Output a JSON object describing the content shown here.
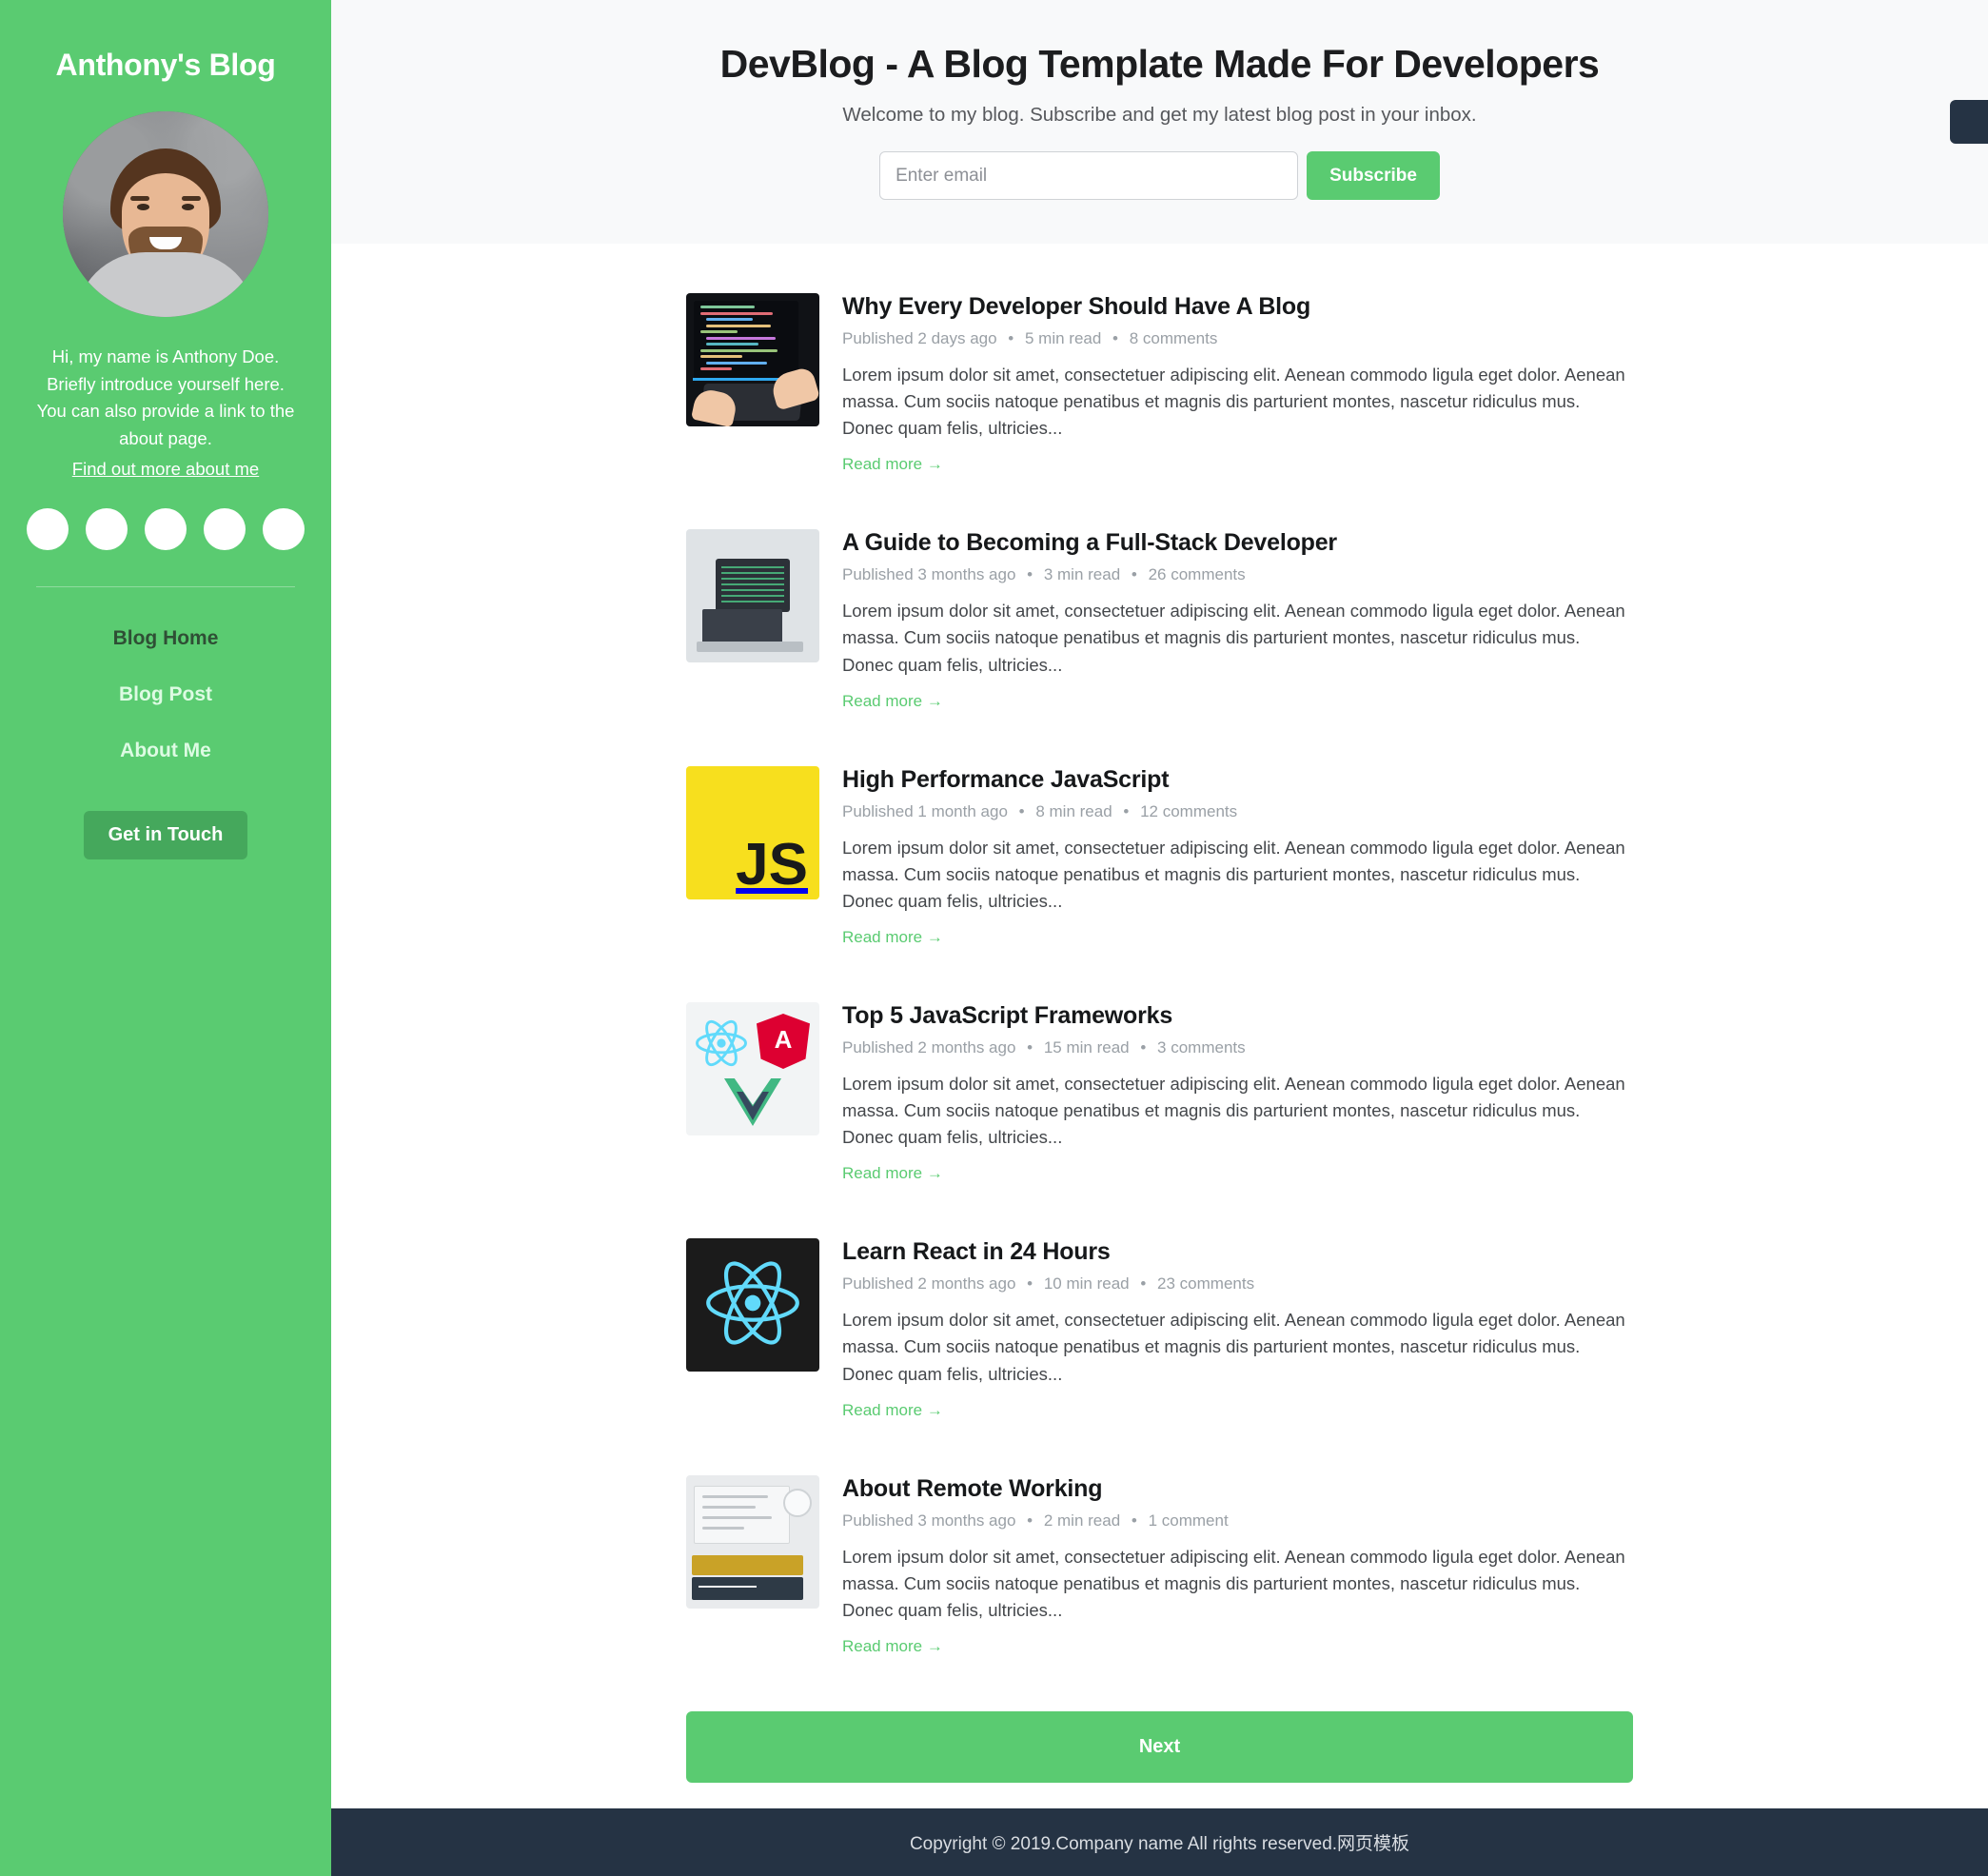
{
  "sidebar": {
    "brand_title": "Anthony's Blog",
    "avatar_name": "avatar",
    "bio_text": "Hi, my name is Anthony Doe. Briefly introduce yourself here. You can also provide a link to the about page.",
    "bio_link": "Find out more about me",
    "socials": [
      {
        "name": "social-icon-1"
      },
      {
        "name": "social-icon-2"
      },
      {
        "name": "social-icon-3"
      },
      {
        "name": "social-icon-4"
      },
      {
        "name": "social-icon-5"
      }
    ],
    "nav": [
      {
        "label": "Blog Home",
        "active": true
      },
      {
        "label": "Blog Post",
        "active": false
      },
      {
        "label": "About Me",
        "active": false
      }
    ],
    "cta_label": "Get in Touch",
    "colors": {
      "background": "#5acb71",
      "cta_background": "#45a85c",
      "active_nav": "#2f4f35",
      "nav": "#ddfbe3"
    }
  },
  "hero": {
    "title": "DevBlog - A Blog Template Made For Developers",
    "subtitle": "Welcome to my blog. Subscribe and get my latest blog post in your inbox.",
    "email_placeholder": "Enter email",
    "email_value": "",
    "subscribe_label": "Subscribe",
    "background": "#f8f9fa",
    "accent": "#5acb71"
  },
  "posts": [
    {
      "title": "Why Every Developer Should Have A Blog",
      "published": "Published 2 days ago",
      "read_time": "5 min read",
      "comments": "8 comments",
      "excerpt": "Lorem ipsum dolor sit amet, consectetuer adipiscing elit. Aenean commodo ligula eget dolor. Aenean massa. Cum sociis natoque penatibus et magnis dis parturient montes, nascetur ridiculus mus. Donec quam felis, ultricies...",
      "read_more": "Read more →",
      "thumb": "laptop-code-photo"
    },
    {
      "title": "A Guide to Becoming a Full-Stack Developer",
      "published": "Published 3 months ago",
      "read_time": "3 min read",
      "comments": "26 comments",
      "excerpt": "Lorem ipsum dolor sit amet, consectetuer adipiscing elit. Aenean commodo ligula eget dolor. Aenean massa. Cum sociis natoque penatibus et magnis dis parturient montes, nascetur ridiculus mus. Donec quam felis, ultricies...",
      "read_more": "Read more →",
      "thumb": "desk-setup-photo"
    },
    {
      "title": "High Performance JavaScript",
      "published": "Published 1 month ago",
      "read_time": "8 min read",
      "comments": "12 comments",
      "excerpt": "Lorem ipsum dolor sit amet, consectetuer adipiscing elit. Aenean commodo ligula eget dolor. Aenean massa. Cum sociis natoque penatibus et magnis dis parturient montes, nascetur ridiculus mus. Donec quam felis, ultricies...",
      "read_more": "Read more →",
      "thumb": "javascript-logo",
      "thumb_text": "JS"
    },
    {
      "title": "Top 5 JavaScript Frameworks",
      "published": "Published 2 months ago",
      "read_time": "15 min read",
      "comments": "3 comments",
      "excerpt": "Lorem ipsum dolor sit amet, consectetuer adipiscing elit. Aenean commodo ligula eget dolor. Aenean massa. Cum sociis natoque penatibus et magnis dis parturient montes, nascetur ridiculus mus. Donec quam felis, ultricies...",
      "read_more": "Read more →",
      "thumb": "frameworks-logos"
    },
    {
      "title": "Learn React in 24 Hours",
      "published": "Published 2 months ago",
      "read_time": "10 min read",
      "comments": "23 comments",
      "excerpt": "Lorem ipsum dolor sit amet, consectetuer adipiscing elit. Aenean commodo ligula eget dolor. Aenean massa. Cum sociis natoque penatibus et magnis dis parturient montes, nascetur ridiculus mus. Donec quam felis, ultricies...",
      "read_more": "Read more →",
      "thumb": "react-logo"
    },
    {
      "title": "About Remote Working",
      "published": "Published 3 months ago",
      "read_time": "2 min read",
      "comments": "1 comment",
      "excerpt": "Lorem ipsum dolor sit amet, consectetuer adipiscing elit. Aenean commodo ligula eget dolor. Aenean massa. Cum sociis natoque penatibus et magnis dis parturient montes, nascetur ridiculus mus. Donec quam felis, ultricies...",
      "read_more": "Read more →",
      "thumb": "books-desk-photo"
    }
  ],
  "pagination": {
    "next_label": "Next"
  },
  "footer": {
    "text": "Copyright © 2019.Company name All rights reserved.网页模板",
    "background": "#253344"
  },
  "separator": "•"
}
